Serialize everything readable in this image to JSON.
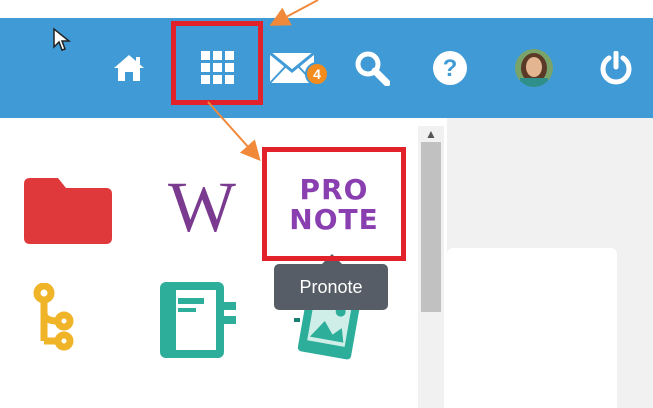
{
  "nav": {
    "icons": [
      "home-icon",
      "apps-grid-icon",
      "mail-icon",
      "search-icon",
      "help-icon",
      "avatar",
      "power-icon"
    ],
    "mail_badge_count": "4"
  },
  "apps": {
    "items": [
      {
        "icon": "folder-icon",
        "color": "#e0393b"
      },
      {
        "icon": "wikipedia-icon",
        "glyph": "W",
        "color": "#7a3a8f"
      },
      {
        "icon": "pronote-icon",
        "logo_line1": "PRO",
        "logo_line2": "NOTE",
        "color": "#8a3fb0"
      },
      {
        "icon": "tree-icon",
        "color": "#f0b429"
      },
      {
        "icon": "notebook-icon",
        "color": "#2cae9a"
      },
      {
        "icon": "photo-album-icon",
        "color": "#2cae9a"
      }
    ],
    "tooltip": "Pronote"
  },
  "colors": {
    "topbar": "#3f9ad6",
    "highlight": "#e2222b",
    "annotation_arrow": "#f0893a"
  }
}
